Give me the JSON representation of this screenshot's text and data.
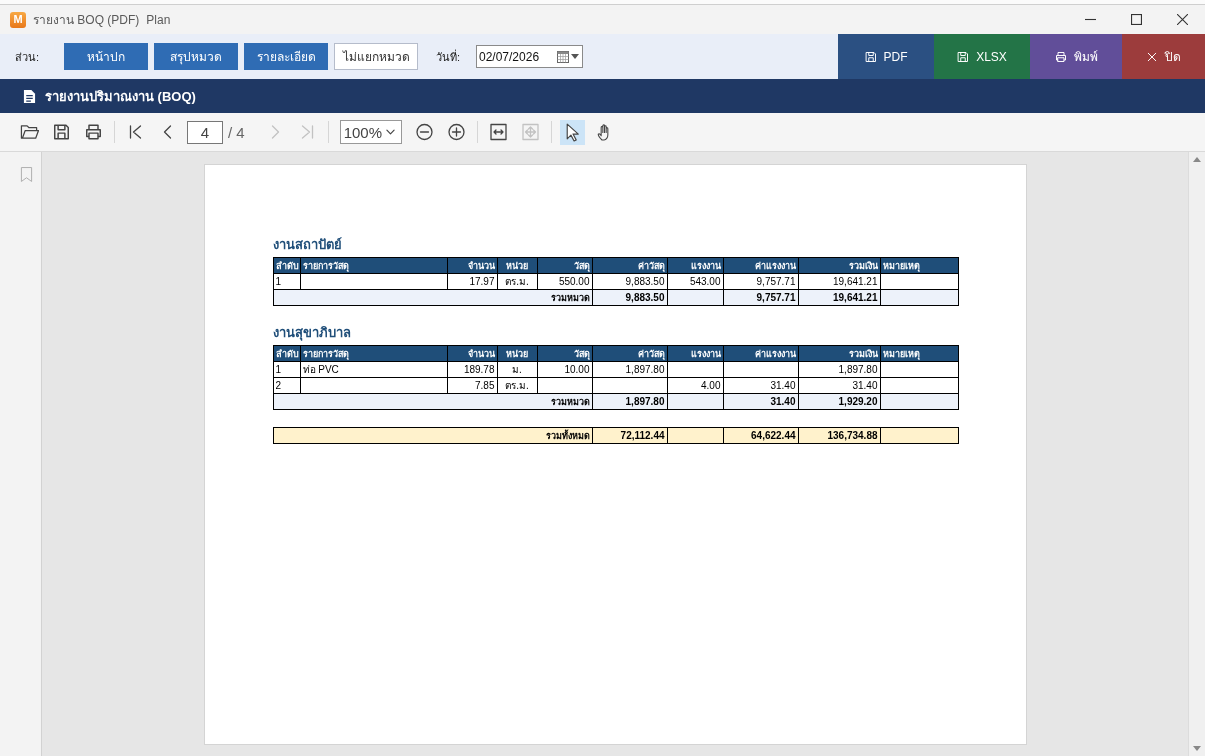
{
  "window": {
    "logo": "M",
    "title": "รายงาน BOQ (PDF)",
    "subtitle": "Plan"
  },
  "toolbar": {
    "section_label": "ส่วน:",
    "sections": [
      {
        "label": "หน้าปก",
        "on": true
      },
      {
        "label": "สรุปหมวด",
        "on": true
      },
      {
        "label": "รายละเอียด",
        "on": true
      },
      {
        "label": "ไม่แยกหมวด",
        "on": false
      }
    ],
    "date_label": "วันที่:",
    "date": "02/07/2026",
    "actions": [
      {
        "kind": "save",
        "label": "PDF",
        "color": "#2b5082"
      },
      {
        "kind": "save",
        "label": "XLSX",
        "color": "#237447"
      },
      {
        "kind": "print",
        "label": "พิมพ์",
        "color": "#614e99"
      },
      {
        "kind": "close",
        "label": "ปิด",
        "color": "#9c3c3c"
      }
    ]
  },
  "report_header": {
    "title": "รายงานปริมาณงาน (BOQ)"
  },
  "viewer_toolbar": {
    "navigation": [
      {
        "disabled": false
      },
      {
        "disabled": false
      },
      {
        "disabled": true
      },
      {
        "disabled": true
      }
    ],
    "page": "4",
    "page_count": "/ 4",
    "zoom": "100%",
    "fit": [
      {
        "disabled": false
      },
      {
        "disabled": true
      }
    ],
    "tools": [
      {
        "selected": true
      },
      {
        "selected": false
      }
    ]
  },
  "document": {
    "sections": [
      {
        "title": "งานสถาปัตย์",
        "columns": [
          "ลำดับ",
          "รายการวัสดุ",
          "จำนวน",
          "หน่วย",
          "วัสดุ",
          "ค่าวัสดุ",
          "แรงงาน",
          "ค่าแรงงาน",
          "รวมเงิน",
          "หมายเหตุ"
        ],
        "rows": [
          {
            "no": "1",
            "qty": "17.97",
            "unit": "ตร.ม.",
            "material_rate": "550.00",
            "material_cost": "9,883.50",
            "labor_rate": "543.00",
            "labor_cost": "9,757.71",
            "total": "19,641.21"
          }
        ],
        "subtotal": {
          "label": "รวมหมวด",
          "material_cost": "9,883.50",
          "labor_cost": "9,757.71",
          "total": "19,641.21"
        }
      },
      {
        "title": "งานสุขาภิบาล",
        "columns": [
          "ลำดับ",
          "รายการวัสดุ",
          "จำนวน",
          "หน่วย",
          "วัสดุ",
          "ค่าวัสดุ",
          "แรงงาน",
          "ค่าแรงงาน",
          "รวมเงิน",
          "หมายเหตุ"
        ],
        "rows": [
          {
            "no": "1",
            "item": "ท่อ PVC",
            "qty": "189.78",
            "unit": "ม.",
            "material_rate": "10.00",
            "material_cost": "1,897.80",
            "total": "1,897.80"
          },
          {
            "no": "2",
            "qty": "7.85",
            "unit": "ตร.ม.",
            "labor_rate": "4.00",
            "labor_cost": "31.40",
            "total": "31.40"
          }
        ],
        "subtotal": {
          "label": "รวมหมวด",
          "material_cost": "1,897.80",
          "labor_cost": "31.40",
          "total": "1,929.20"
        }
      }
    ],
    "grand_total": {
      "label": "รวมทั้งหมด",
      "material_cost": "72,112.44",
      "labor_cost": "64,622.44",
      "total": "136,734.88"
    }
  }
}
